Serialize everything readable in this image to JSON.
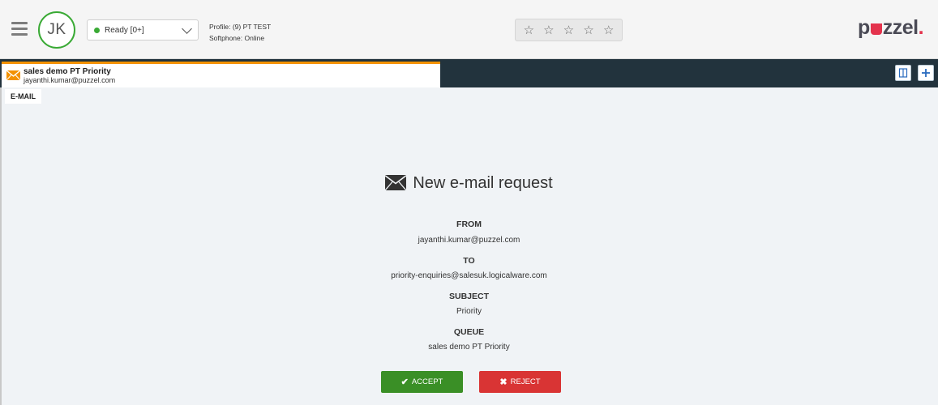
{
  "header": {
    "avatar_initials": "JK",
    "status": {
      "label": "Ready [0+]",
      "color": "#3aaa35"
    },
    "profile": "Profile: (9) PT TEST",
    "softphone": "Softphone: Online",
    "rating": {
      "max": 5,
      "value": 0
    },
    "logo": {
      "prefix": "p",
      "suffix": "zzel",
      "dot": "."
    }
  },
  "tab": {
    "title": "sales demo PT Priority",
    "subtitle": "jayanthi.kumar@puzzel.com",
    "accent_color": "#f39200"
  },
  "channel_label": "E-MAIL",
  "request": {
    "title": "New e-mail request",
    "fields": [
      {
        "label": "FROM",
        "value": "jayanthi.kumar@puzzel.com"
      },
      {
        "label": "TO",
        "value": "priority-enquiries@salesuk.logicalware.com"
      },
      {
        "label": "SUBJECT",
        "value": "Priority"
      },
      {
        "label": "QUEUE",
        "value": "sales demo PT Priority"
      }
    ]
  },
  "actions": {
    "accept": "ACCEPT",
    "reject": "REJECT"
  },
  "colors": {
    "accept": "#3a8f26",
    "reject": "#d93434",
    "tabbar": "#22333d"
  }
}
